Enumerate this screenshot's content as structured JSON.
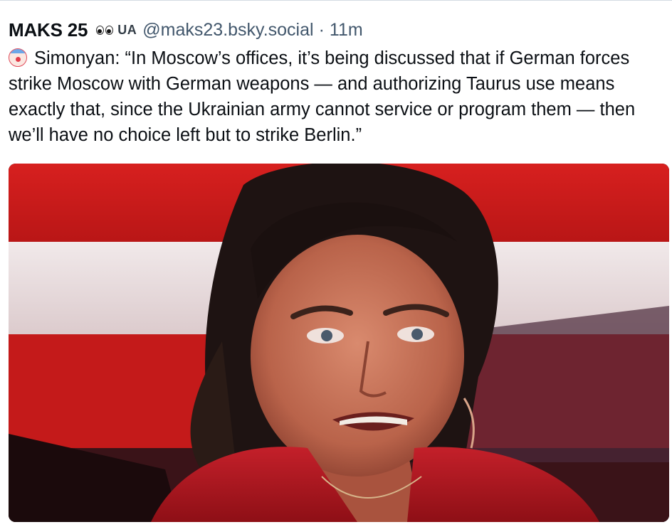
{
  "post": {
    "author": {
      "display_name": "MAKS 25",
      "badge_icon": "eyes-icon",
      "country_tag": "UA",
      "handle": "@maks23.bsky.social"
    },
    "separator": "·",
    "timestamp": "11m",
    "emoji_icon": "clown-face-icon",
    "text": "Simonyan: “In Moscow’s offices, it’s being discussed that if German forces strike Moscow with German weapons — and authorizing Taurus use means exactly that, since the Ukrainian army cannot service or program them — then we’ll have no choice left but to strike Berlin.”"
  },
  "colors": {
    "text_primary": "#0b0f14",
    "text_secondary": "#42576c",
    "background": "#ffffff",
    "studio_red": "#c81e1e",
    "jacket_red": "#b0141c"
  }
}
